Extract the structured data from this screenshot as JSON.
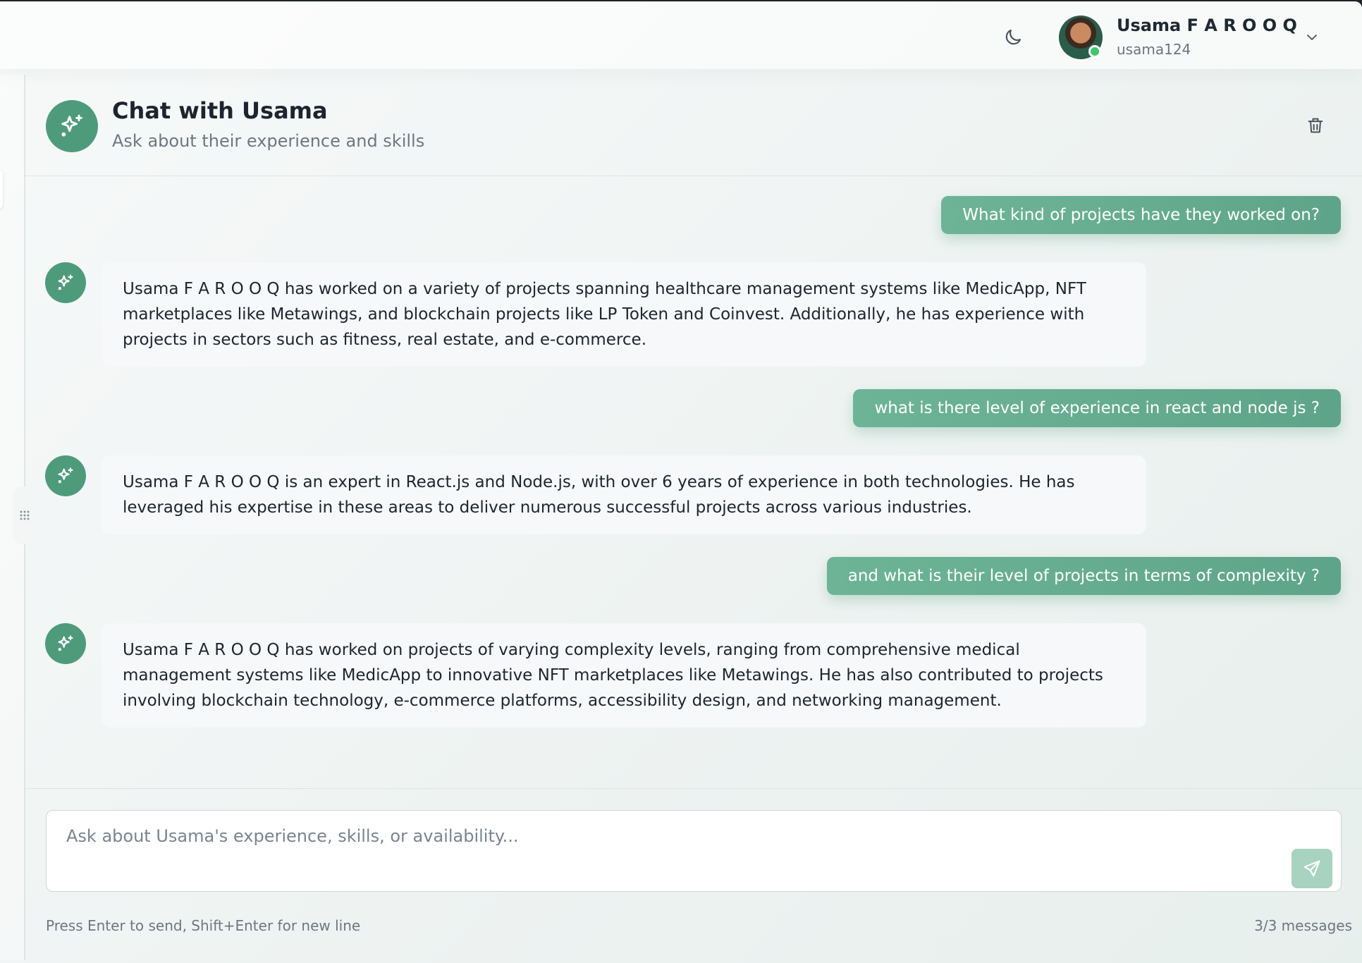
{
  "header": {
    "theme_icon": "moon-icon",
    "user": {
      "name": "Usama F A R O O Q",
      "handle": "usama124",
      "status": "online"
    },
    "menu_icon": "chevron-down-icon"
  },
  "chat": {
    "title": "Chat with Usama",
    "subtitle": "Ask about their experience and skills",
    "delete_icon": "trash-icon"
  },
  "messages": [
    {
      "role": "user",
      "text": "What kind of projects have they worked on?"
    },
    {
      "role": "assistant",
      "text": "Usama F A R O O Q has worked on a variety of projects spanning healthcare management systems like MedicApp, NFT marketplaces like Metawings, and blockchain projects like LP Token and Coinvest. Additionally, he has experience with projects in sectors such as fitness, real estate, and e-commerce."
    },
    {
      "role": "user",
      "text": "what is there level of experience in react and node js ?"
    },
    {
      "role": "assistant",
      "text": "Usama F A R O O Q is an expert in React.js and Node.js, with over 6 years of experience in both technologies. He has leveraged his expertise in these areas to deliver numerous successful projects across various industries."
    },
    {
      "role": "user",
      "text": "and what is their level of projects in terms of complexity ?"
    },
    {
      "role": "assistant",
      "text": "Usama F A R O O Q has worked on projects of varying complexity levels, ranging from comprehensive medical management systems like MedicApp to innovative NFT marketplaces like Metawings. He has also contributed to projects involving blockchain technology, e-commerce platforms, accessibility design, and networking management."
    }
  ],
  "composer": {
    "value": "",
    "placeholder": "Ask about Usama's experience, skills, or availability...",
    "hint": "Press Enter to send, Shift+Enter for new line",
    "count": "3/3 messages",
    "send_icon": "send-icon"
  },
  "colors": {
    "accent": "#4e9b7c",
    "user_bubble": "#62a88d",
    "send_button": "#a8d3c1",
    "online": "#43c46a"
  }
}
